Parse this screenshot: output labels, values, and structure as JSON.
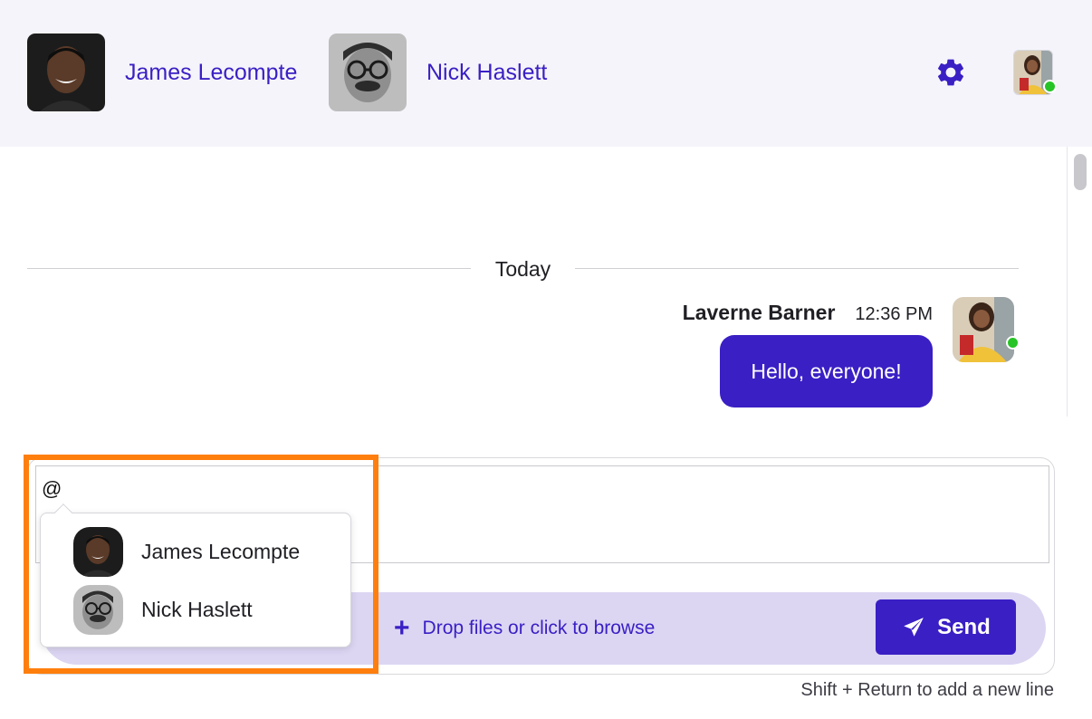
{
  "header": {
    "participants": [
      {
        "name": "James Lecompte"
      },
      {
        "name": "Nick Haslett"
      }
    ]
  },
  "messages": {
    "day_label": "Today",
    "items": [
      {
        "author": "Laverne Barner",
        "time": "12:36 PM",
        "text": "Hello, everyone!"
      }
    ]
  },
  "composer": {
    "input_value": "@",
    "drop_label": "Drop files or click to browse",
    "send_label": "Send",
    "hint": "Shift + Return to add a new line"
  },
  "mentions": {
    "items": [
      {
        "name": "James Lecompte"
      },
      {
        "name": "Nick Haslett"
      }
    ]
  },
  "colors": {
    "accent": "#3a1fc4",
    "header_bg": "#f5f4fa",
    "action_bar_bg": "#dcd6f3",
    "presence": "#26c426",
    "highlight": "#ff7f0e"
  },
  "icons": {
    "settings": "gear-icon",
    "add_files": "plus-icon",
    "send": "paper-plane-icon"
  }
}
